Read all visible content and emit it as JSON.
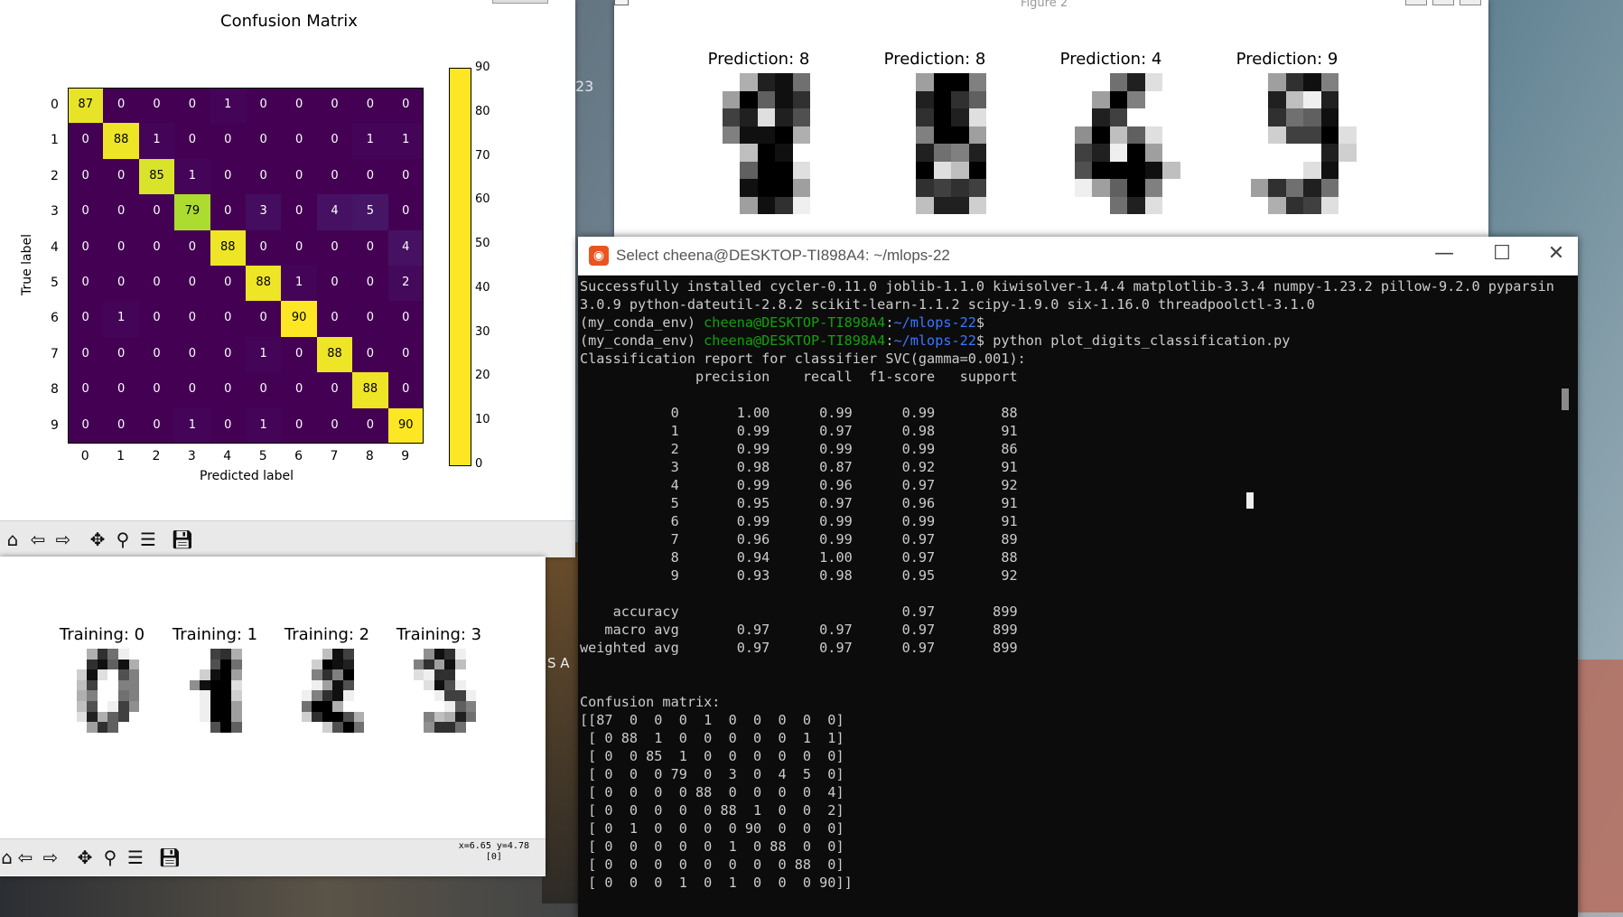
{
  "confusion_window": {
    "title": "Confusion Matrix",
    "ylabel": "True label",
    "xlabel": "Predicted label",
    "labels": [
      "0",
      "1",
      "2",
      "3",
      "4",
      "5",
      "6",
      "7",
      "8",
      "9"
    ],
    "matrix": [
      [
        87,
        0,
        0,
        0,
        1,
        0,
        0,
        0,
        0,
        0
      ],
      [
        0,
        88,
        1,
        0,
        0,
        0,
        0,
        0,
        1,
        1
      ],
      [
        0,
        0,
        85,
        1,
        0,
        0,
        0,
        0,
        0,
        0
      ],
      [
        0,
        0,
        0,
        79,
        0,
        3,
        0,
        4,
        5,
        0
      ],
      [
        0,
        0,
        0,
        0,
        88,
        0,
        0,
        0,
        0,
        4
      ],
      [
        0,
        0,
        0,
        0,
        0,
        88,
        1,
        0,
        0,
        2
      ],
      [
        0,
        1,
        0,
        0,
        0,
        0,
        90,
        0,
        0,
        0
      ],
      [
        0,
        0,
        0,
        0,
        0,
        1,
        0,
        88,
        0,
        0
      ],
      [
        0,
        0,
        0,
        0,
        0,
        0,
        0,
        0,
        88,
        0
      ],
      [
        0,
        0,
        0,
        1,
        0,
        1,
        0,
        0,
        0,
        90
      ]
    ],
    "colorbar_ticks": [
      "90",
      "80",
      "70",
      "60",
      "50",
      "40",
      "30",
      "20",
      "10",
      "0"
    ],
    "colorbar_range": [
      0,
      90
    ]
  },
  "toolbar_icons": [
    "home-icon",
    "back-icon",
    "forward-icon",
    "pan-icon",
    "zoom-icon",
    "configure-icon",
    "save-icon"
  ],
  "training_window": {
    "titles": [
      "Training: 0",
      "Training: 1",
      "Training: 2",
      "Training: 3"
    ],
    "coords": "x=6.65 y=4.78",
    "coords_value": "[0]"
  },
  "figure2_window": {
    "title": "Figure 2",
    "titles": [
      "Prediction: 8",
      "Prediction: 8",
      "Prediction: 4",
      "Prediction: 9"
    ]
  },
  "terminal": {
    "title": "Select cheena@DESKTOP-TI898A4: ~/mlops-22",
    "lines": [
      {
        "t": "Successfully installed cycler-0.11.0 joblib-1.1.0 kiwisolver-1.4.4 matplotlib-3.3.4 numpy-1.23.2 pillow-9.2.0 pyparsing-"
      },
      {
        "t": "3.0.9 python-dateutil-2.8.2 scikit-learn-1.1.2 scipy-1.9.0 six-1.16.0 threadpoolctl-3.1.0"
      },
      {
        "prompt": "(my_conda_env) ",
        "user": "cheena@DESKTOP-TI898A4",
        "path": "~/mlops-22",
        "cmd": "$"
      },
      {
        "prompt": "(my_conda_env) ",
        "user": "cheena@DESKTOP-TI898A4",
        "path": "~/mlops-22",
        "cmd": "$ python plot_digits_classification.py"
      },
      {
        "t": "Classification report for classifier SVC(gamma=0.001):"
      },
      {
        "t": "              precision    recall  f1-score   support"
      },
      {
        "t": ""
      },
      {
        "t": "           0       1.00      0.99      0.99        88"
      },
      {
        "t": "           1       0.99      0.97      0.98        91"
      },
      {
        "t": "           2       0.99      0.99      0.99        86"
      },
      {
        "t": "           3       0.98      0.87      0.92        91"
      },
      {
        "t": "           4       0.99      0.96      0.97        92"
      },
      {
        "t": "           5       0.95      0.97      0.96        91"
      },
      {
        "t": "           6       0.99      0.99      0.99        91"
      },
      {
        "t": "           7       0.96      0.99      0.97        89"
      },
      {
        "t": "           8       0.94      1.00      0.97        88"
      },
      {
        "t": "           9       0.93      0.98      0.95        92"
      },
      {
        "t": ""
      },
      {
        "t": "    accuracy                           0.97       899"
      },
      {
        "t": "   macro avg       0.97      0.97      0.97       899"
      },
      {
        "t": "weighted avg       0.97      0.97      0.97       899"
      },
      {
        "t": ""
      },
      {
        "t": ""
      },
      {
        "t": "Confusion matrix:"
      },
      {
        "t": "[[87  0  0  0  1  0  0  0  0  0]"
      },
      {
        "t": " [ 0 88  1  0  0  0  0  0  1  1]"
      },
      {
        "t": " [ 0  0 85  1  0  0  0  0  0  0]"
      },
      {
        "t": " [ 0  0  0 79  0  3  0  4  5  0]"
      },
      {
        "t": " [ 0  0  0  0 88  0  0  0  0  4]"
      },
      {
        "t": " [ 0  0  0  0  0 88  1  0  0  2]"
      },
      {
        "t": " [ 0  1  0  0  0  0 90  0  0  0]"
      },
      {
        "t": " [ 0  0  0  0  0  1  0 88  0  0]"
      },
      {
        "t": " [ 0  0  0  0  0  0  0  0 88  0]"
      },
      {
        "t": " [ 0  0  0  1  0  1  0  0  0 90]]"
      }
    ]
  },
  "desktop_text": {
    "left_fragment": "23",
    "badge": "S A"
  }
}
